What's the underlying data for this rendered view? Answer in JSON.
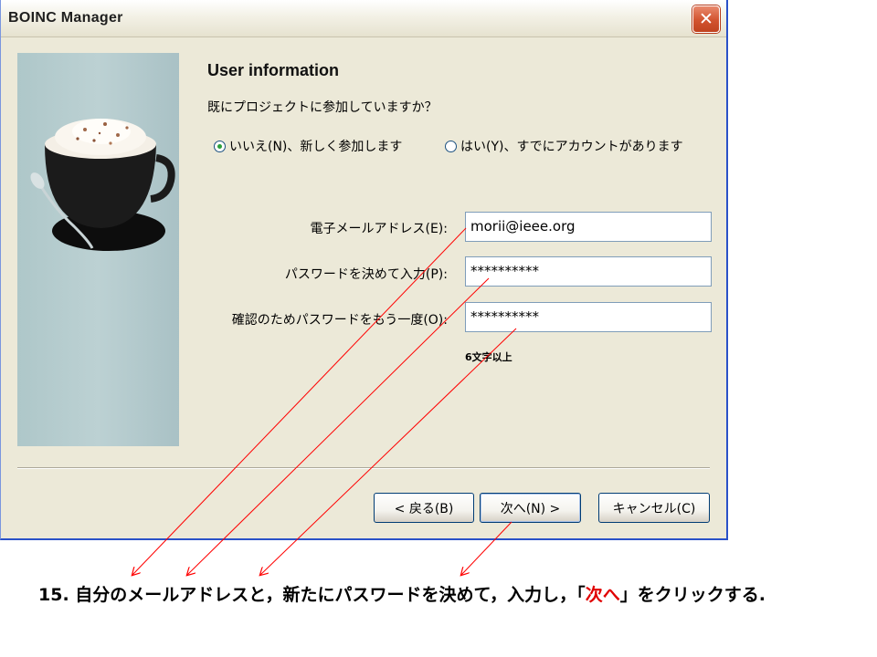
{
  "window": {
    "title": "BOINC Manager"
  },
  "page": {
    "heading": "User information",
    "question": "既にプロジェクトに参加していますか？",
    "radio_no": "いいえ(N)、新しく参加します",
    "radio_yes": "はい(Y)、すでにアカウントがあります",
    "radio_selected": "no"
  },
  "form": {
    "email_label": "電子メールアドレス(E):",
    "email_value": "morii@ieee.org",
    "password_label": "パスワードを決めて入力(P):",
    "password_value": "**********",
    "confirm_label": "確認のためパスワードをもう一度(O):",
    "confirm_value": "**********",
    "hint": "6文字以上"
  },
  "buttons": {
    "back": "< 戻る(B)",
    "next": "次へ(N) >",
    "cancel": "キャンセル(C)"
  },
  "caption": {
    "prefix": "15. 自分のメールアドレスと，新たにパスワードを決めて，入力し，「",
    "highlight": "次へ",
    "suffix": "」をクリックする."
  },
  "colors": {
    "annotation_red": "#e00000",
    "arrow_red": "#ff0000",
    "selected_radio": "#2aa03a"
  }
}
